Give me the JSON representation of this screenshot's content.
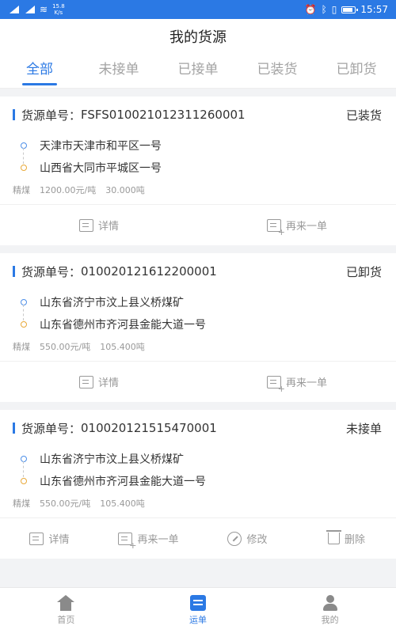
{
  "status_bar": {
    "net_speed_value": "15.8",
    "net_speed_unit": "K/s",
    "time": "15:57"
  },
  "header": {
    "title": "我的货源"
  },
  "tabs": [
    {
      "label": "全部"
    },
    {
      "label": "未接单"
    },
    {
      "label": "已接单"
    },
    {
      "label": "已装货"
    },
    {
      "label": "已卸货"
    }
  ],
  "order_prefix": "货源单号：",
  "orders": [
    {
      "number": "FSFS010021012311260001",
      "status": "已装货",
      "origin": "天津市天津市和平区一号",
      "destination": "山西省大同市平城区一号",
      "cargo": "精煤",
      "price": "1200.00元/吨",
      "weight": "30.000吨",
      "actions": [
        "详情",
        "再来一单"
      ]
    },
    {
      "number": "010020121612200001",
      "status": "已卸货",
      "origin": "山东省济宁市汶上县义桥煤矿",
      "destination": "山东省德州市齐河县金能大道一号",
      "cargo": "精煤",
      "price": "550.00元/吨",
      "weight": "105.400吨",
      "actions": [
        "详情",
        "再来一单"
      ]
    },
    {
      "number": "010020121515470001",
      "status": "未接单",
      "origin": "山东省济宁市汶上县义桥煤矿",
      "destination": "山东省德州市齐河县金能大道一号",
      "cargo": "精煤",
      "price": "550.00元/吨",
      "weight": "105.400吨",
      "actions": [
        "详情",
        "再来一单",
        "修改",
        "删除"
      ]
    }
  ],
  "bottom_nav": [
    {
      "label": "首页",
      "icon": "home-icon"
    },
    {
      "label": "运单",
      "icon": "waybill-icon"
    },
    {
      "label": "我的",
      "icon": "user-icon"
    }
  ],
  "colors": {
    "accent": "#2b79e4",
    "origin_dot": "#4d8fe8",
    "destination_dot": "#e8a93a"
  }
}
